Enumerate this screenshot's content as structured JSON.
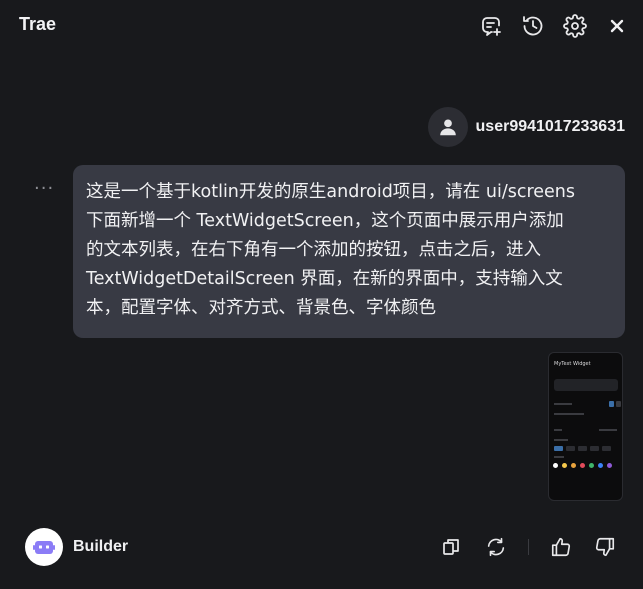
{
  "app": {
    "title": "Trae"
  },
  "header": {
    "icons": [
      "new-chat-icon",
      "history-icon",
      "settings-icon",
      "close-icon"
    ]
  },
  "user": {
    "name": "user9941017233631",
    "avatar_icon": "person-icon"
  },
  "message": {
    "more_icon": "···",
    "lines": [
      "这是一个基于kotlin开发的原生android项目，请在 ui/screens",
      "下面新增一个 TextWidgetScreen，这个页面中展示用户添加",
      "的文本列表，在右下角有一个添加的按钮，点击之后，进入",
      "TextWidgetDetailScreen 界面，在新的界面中，支持输入文",
      "本，配置字体、对齐方式、背景色、字体颜色"
    ],
    "attachment": {
      "title": "MyText Widget",
      "preview_colors": [
        "#ffffff",
        "#f5c84c",
        "#e8a33d",
        "#e24b5b",
        "#3fb56a",
        "#3b82f6",
        "#8e5bd6"
      ]
    }
  },
  "assistant": {
    "name": "Builder",
    "avatar_icon": "robot-icon",
    "actions": [
      "copy-icon",
      "regenerate-icon",
      "thumbs-up-icon",
      "thumbs-down-icon"
    ]
  },
  "colors": {
    "background": "#18191c",
    "bubble": "#383a44",
    "text": "#f1f1f3",
    "robot": "#8b7cf6"
  }
}
